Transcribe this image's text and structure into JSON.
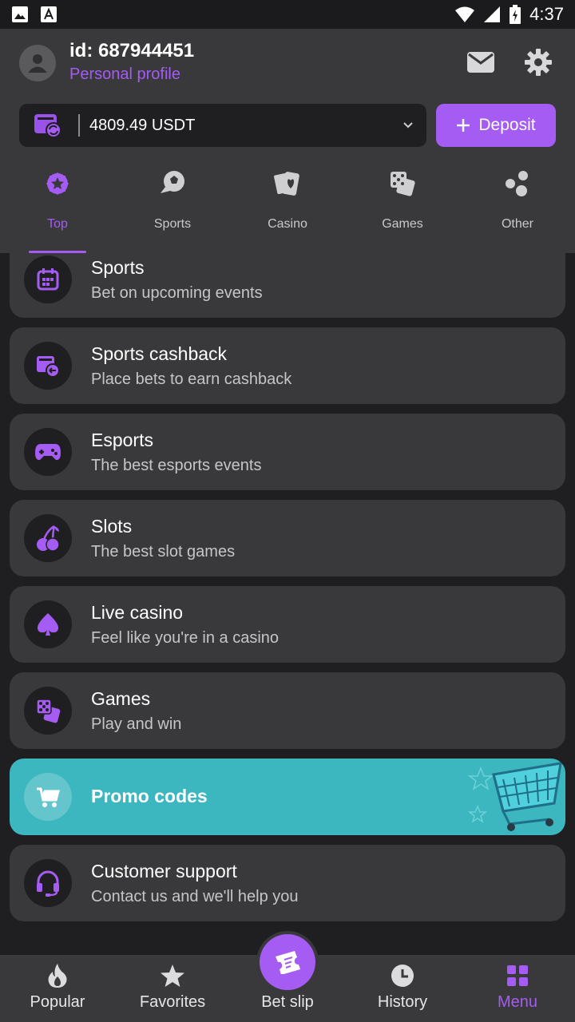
{
  "status": {
    "time": "4:37"
  },
  "profile": {
    "id_label": "id: 687944451",
    "link": "Personal profile"
  },
  "balance": {
    "amount": "4809.49 USDT"
  },
  "deposit": {
    "label": "Deposit"
  },
  "categories": [
    {
      "label": "Top",
      "icon": "badge-star-icon",
      "active": true
    },
    {
      "label": "Sports",
      "icon": "soccer-ball-icon",
      "active": false
    },
    {
      "label": "Casino",
      "icon": "playing-cards-icon",
      "active": false
    },
    {
      "label": "Games",
      "icon": "dice-icon",
      "active": false
    },
    {
      "label": "Other",
      "icon": "bubbles-icon",
      "active": false
    }
  ],
  "menu": [
    {
      "title": "Sports",
      "subtitle": "Bet on upcoming events",
      "icon": "calendar-icon"
    },
    {
      "title": "Sports cashback",
      "subtitle": "Place bets to earn cashback",
      "icon": "cashback-icon"
    },
    {
      "title": "Esports",
      "subtitle": "The best esports events",
      "icon": "gamepad-icon"
    },
    {
      "title": "Slots",
      "subtitle": "The best slot games",
      "icon": "cherries-icon"
    },
    {
      "title": "Live casino",
      "subtitle": "Feel like you're in a casino",
      "icon": "spade-icon"
    },
    {
      "title": "Games",
      "subtitle": "Play and win",
      "icon": "dice-icon"
    },
    {
      "title": "Promo codes",
      "subtitle": "",
      "icon": "cart-icon"
    },
    {
      "title": "Customer support",
      "subtitle": "Contact us and we'll help you",
      "icon": "headset-icon"
    }
  ],
  "bottom_nav": [
    {
      "label": "Popular",
      "icon": "fire-icon",
      "active": false
    },
    {
      "label": "Favorites",
      "icon": "star-icon",
      "active": false
    },
    {
      "label": "Bet slip",
      "icon": "ticket-icon",
      "active": false
    },
    {
      "label": "History",
      "icon": "clock-icon",
      "active": false
    },
    {
      "label": "Menu",
      "icon": "grid-icon",
      "active": true
    }
  ],
  "colors": {
    "accent": "#a45cf2",
    "promo": "#3cb7bf",
    "surface": "#39393c",
    "background": "#1f1f21"
  }
}
